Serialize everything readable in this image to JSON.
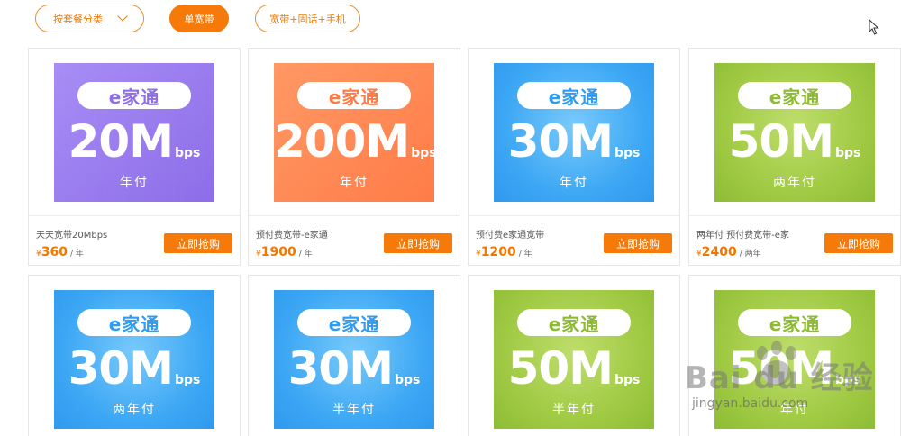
{
  "filters": [
    {
      "label": "按套餐分类",
      "active": false,
      "has_dropdown": true
    },
    {
      "label": "单宽带",
      "active": true,
      "has_dropdown": false
    },
    {
      "label": "宽带+固话+手机",
      "active": false,
      "has_dropdown": false
    }
  ],
  "brand": "e家通",
  "unit": "bps",
  "buy_label": "立即抢购",
  "currency": "¥",
  "products": [
    {
      "speed": "20M",
      "term": "年付",
      "name": "天天宽带20Mbps",
      "price": "360",
      "per": "/ 年",
      "theme": "purple",
      "color": "#9e7ff0"
    },
    {
      "speed": "200M",
      "term": "年付",
      "name": "预付费宽带-e家通",
      "price": "1900",
      "per": "/ 年",
      "theme": "orange",
      "color": "#ff8a55"
    },
    {
      "speed": "30M",
      "term": "年付",
      "name": "预付费e家通宽带",
      "price": "1200",
      "per": "/ 年",
      "theme": "blue",
      "color": "#3fa9f5"
    },
    {
      "speed": "50M",
      "term": "两年付",
      "name": "两年付 预付费宽带-e家",
      "price": "2400",
      "per": "/ 两年",
      "theme": "green",
      "color": "#9cc73f"
    },
    {
      "speed": "30M",
      "term": "两年付",
      "theme": "blue",
      "color": "#3fa9f5"
    },
    {
      "speed": "30M",
      "term": "半年付",
      "theme": "blue",
      "color": "#3fa9f5"
    },
    {
      "speed": "50M",
      "term": "半年付",
      "theme": "green",
      "color": "#9cc73f"
    },
    {
      "speed": "50M",
      "term": "年付",
      "theme": "green",
      "color": "#9cc73f"
    }
  ],
  "watermark": {
    "text": "Bai du 经验",
    "sub": "jingyan.baidu.com"
  }
}
